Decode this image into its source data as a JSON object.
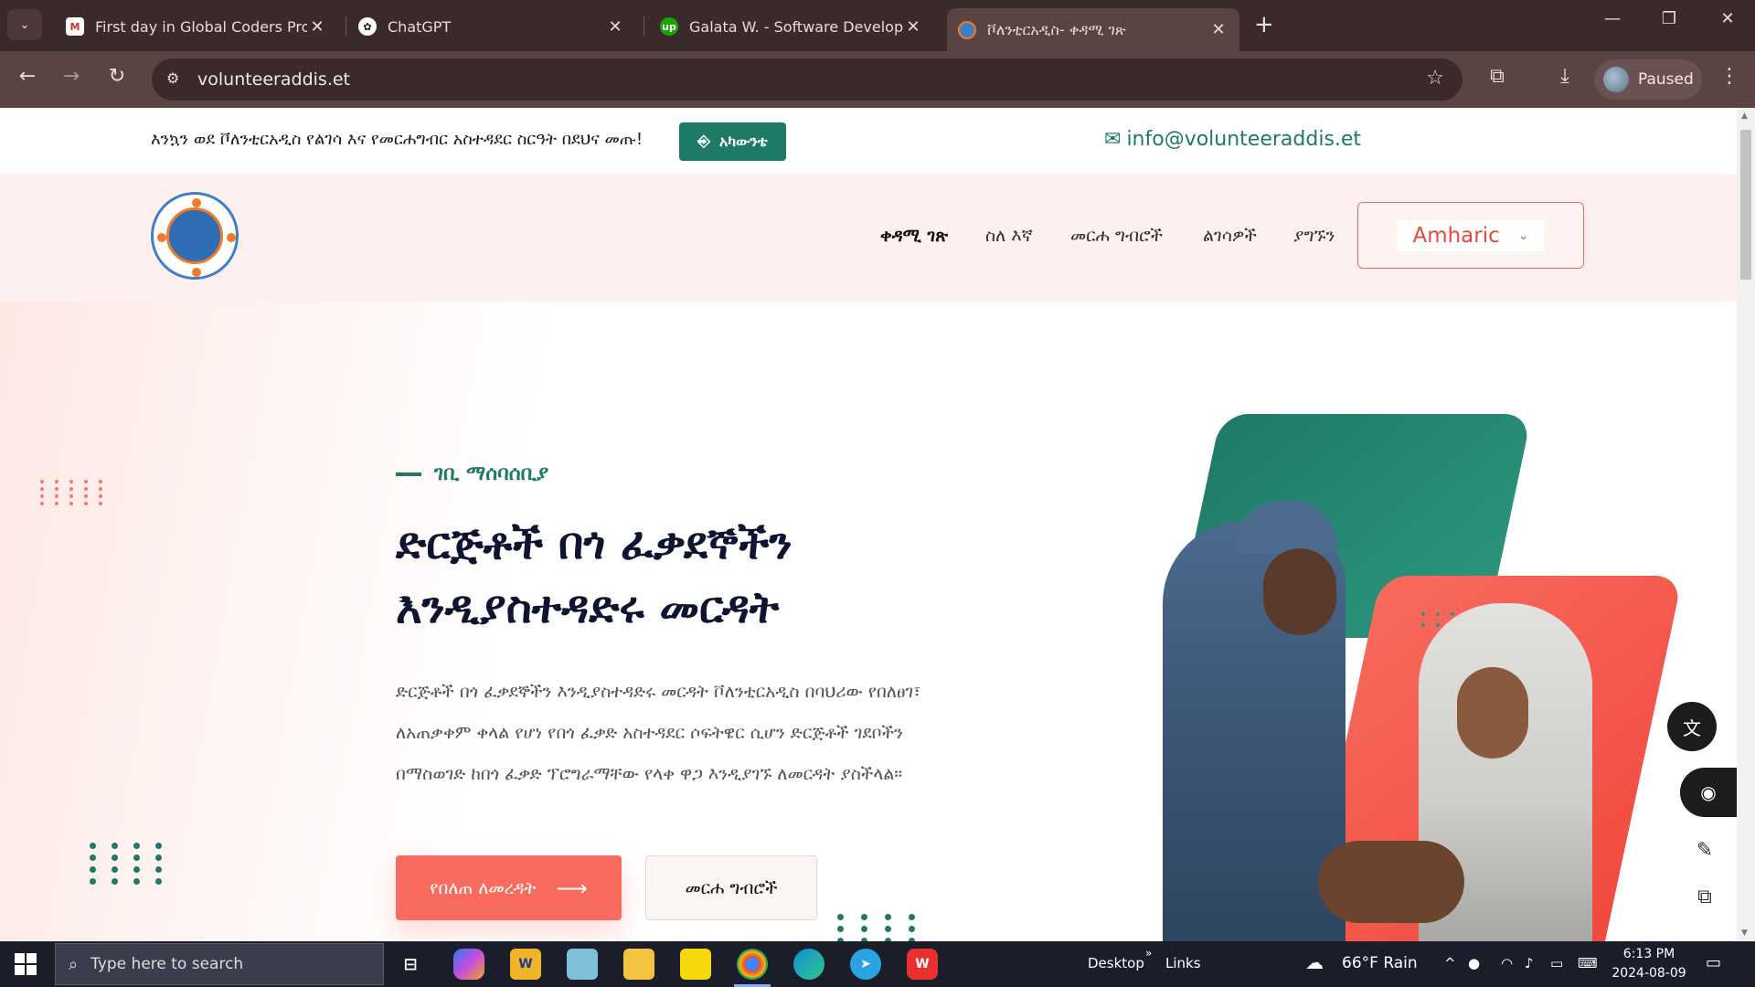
{
  "browser": {
    "tabs": [
      {
        "title": "First day in Global Coders Program",
        "favicon": "gmail-icon",
        "active": false
      },
      {
        "title": "ChatGPT",
        "favicon": "chatgpt-icon",
        "active": false
      },
      {
        "title": "Galata W. - Software Developer - U",
        "favicon": "upwork-icon",
        "active": false
      },
      {
        "title": "ቮለንቲርአዲስ- ቀዳሚ ገጽ",
        "favicon": "site-logo-icon",
        "active": true
      }
    ],
    "url": "volunteeraddis.et",
    "profile_label": "Paused"
  },
  "topbar": {
    "welcome": "እንኳን ወደ ቮለንቲርአዲስ የልገሳ እና የመርሐግብር አስተዳደር ስርዓት በደህና መጡ!",
    "account_label": "አካውንቴ",
    "email": "info@volunteeraddis.et"
  },
  "nav": {
    "items": [
      "ቀዳሚ ገጽ",
      "ስለ እኛ",
      "መርሐ ግብሮች",
      "ልገሳዎች",
      "ያግኙን"
    ],
    "language": "Amharic"
  },
  "hero": {
    "tagline": "ገቢ ማሰባሰቢያ",
    "title_line1": "ድርጅቶች በጎ ፈቃደኞችን",
    "title_line2": "እንዲያስተዳድሩ መርዳት",
    "desc_line1": "ድርጅቶች በጎ ፈቃደኞችን እንዲያስተዳድሩ መርዳት ቮለንቲርአዲስ በባህሪው የበለፀገ፣",
    "desc_line2": "ለአጠቃቀም ቀላል የሆነ የበጎ ፈቃድ አስተዳደር ሶፍትዌር ሲሆን ድርጅቶች ገደቦችን",
    "desc_line3": "በማስወገድ ከበጎ ፈቃድ ፕሮግራማቸው የላቀ ዋጋ እንዲያገኙ ለመርዳት ያስችላል።",
    "learn_more": "የበለጠ ለመረዳት",
    "programs": "መርሐ ግብሮች"
  },
  "taskbar": {
    "search_placeholder": "Type here to search",
    "desktop": "Desktop",
    "links": "Links",
    "weather": "66°F  Rain",
    "time": "6:13 PM",
    "date": "2024-08-09"
  },
  "colors": {
    "brand_green": "#1e7a66",
    "brand_coral": "#f86b5e",
    "chrome_dark": "#3b2a2a"
  }
}
